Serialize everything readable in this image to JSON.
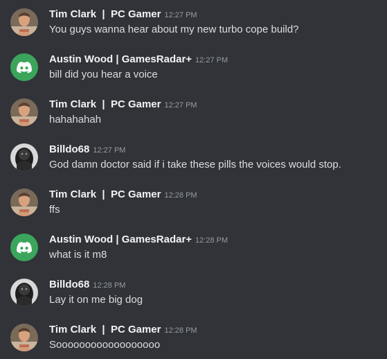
{
  "messages": [
    {
      "author": "Tim Clark  |  PC Gamer",
      "time": "12:27 PM",
      "text": "You guys wanna hear about my new turbo cope build?",
      "avatar": "tim-clark-photo"
    },
    {
      "author": "Austin Wood | GamesRadar+",
      "time": "12:27 PM",
      "text": "bill did you hear a voice",
      "avatar": "discord-logo"
    },
    {
      "author": "Tim Clark  |  PC Gamer",
      "time": "12:27 PM",
      "text": "hahahahah",
      "avatar": "tim-clark-photo"
    },
    {
      "author": "Billdo68",
      "time": "12:27 PM",
      "text": "God damn doctor said if i take these pills the voices would stop.",
      "avatar": "billdo-dark-photo"
    },
    {
      "author": "Tim Clark  |  PC Gamer",
      "time": "12:28 PM",
      "text": "ffs",
      "avatar": "tim-clark-photo"
    },
    {
      "author": "Austin Wood | GamesRadar+",
      "time": "12:28 PM",
      "text": "what is it m8",
      "avatar": "discord-logo"
    },
    {
      "author": "Billdo68",
      "time": "12:28 PM",
      "text": "Lay it on me big dog",
      "avatar": "billdo-dark-photo"
    },
    {
      "author": "Tim Clark  |  PC Gamer",
      "time": "12:28 PM",
      "text": "Soooooooooooooooooo",
      "avatar": "tim-clark-photo"
    }
  ],
  "colors": {
    "background": "#313338",
    "username": "#f2f3f5",
    "message_text": "#dbdee1",
    "timestamp": "#949ba4",
    "discord_avatar_bg": "#3ba55c"
  }
}
